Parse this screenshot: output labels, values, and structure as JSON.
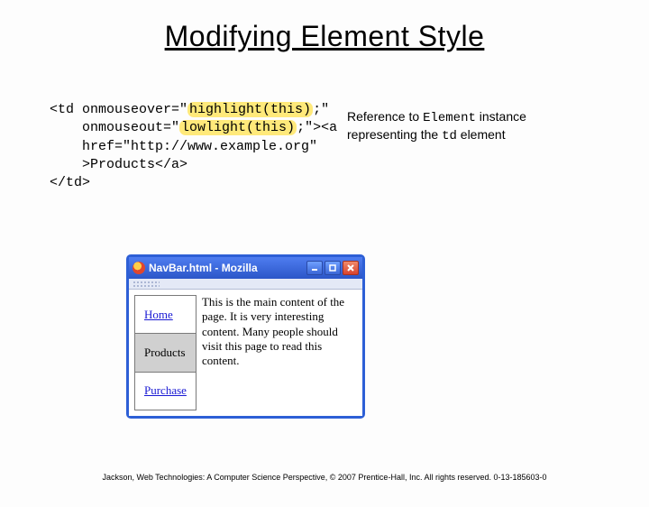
{
  "slide": {
    "title": "Modifying Element Style"
  },
  "code": {
    "line1a": "<td onmouseover=\"",
    "line1b": "highlight(this)",
    "line1c": ";\"",
    "line2a": "    onmouseout=\"",
    "line2b": "lowlight(this)",
    "line2c": ";\"><a",
    "line3": "    href=\"http://www.example.org\"",
    "line4": "    >Products</a>",
    "line5": "</td>"
  },
  "annotation": {
    "pre": "Reference to ",
    "elem": "Element",
    "mid": " instance representing the ",
    "td": "td",
    "post": " element"
  },
  "window": {
    "title": "NavBar.html - Mozilla"
  },
  "nav": {
    "items": [
      {
        "label": "Home"
      },
      {
        "label": "Products"
      },
      {
        "label": "Purchase"
      }
    ]
  },
  "main": {
    "text": "This is the main content of the page. It is very interesting content. Many people should visit this page to read this content."
  },
  "footer": {
    "text": "Jackson, Web Technologies: A Computer Science Perspective, © 2007 Prentice-Hall, Inc. All rights reserved. 0-13-185603-0"
  }
}
